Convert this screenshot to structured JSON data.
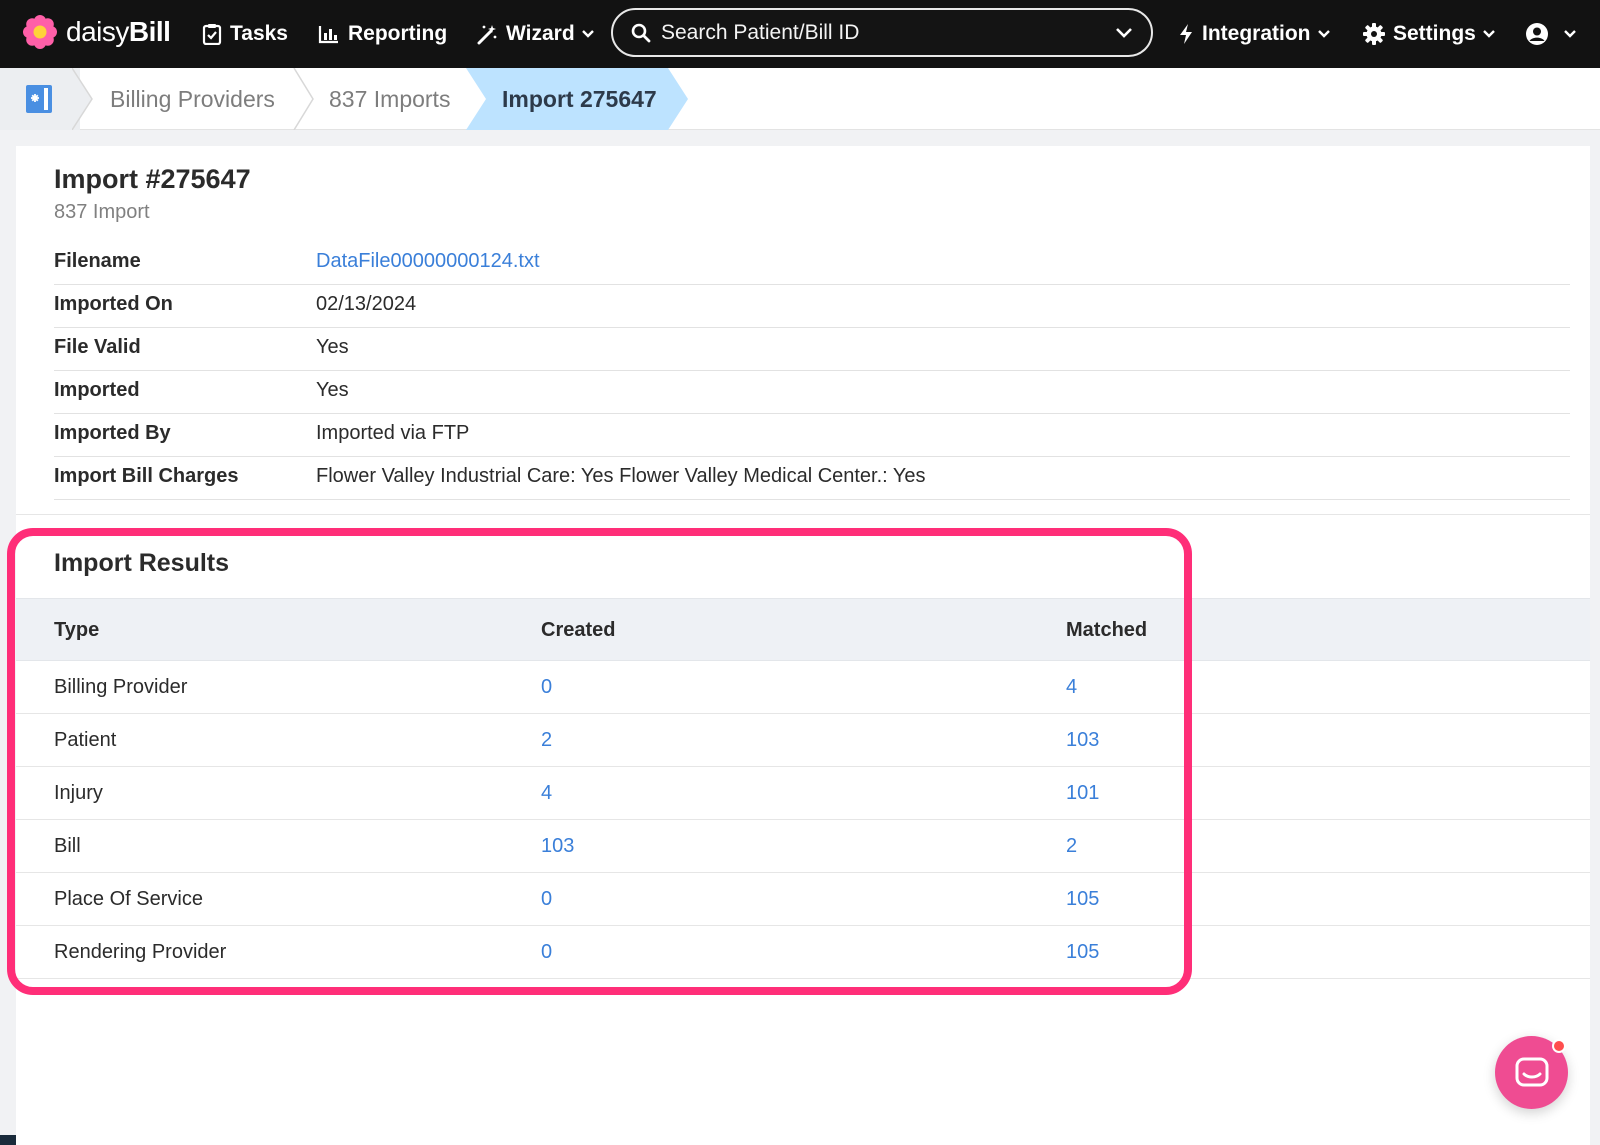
{
  "brand": {
    "name_light": "daisy",
    "name_bold": "Bill"
  },
  "nav": {
    "tasks": "Tasks",
    "reporting": "Reporting",
    "wizard": "Wizard",
    "search_placeholder": "Search Patient/Bill ID",
    "integration": "Integration",
    "settings": "Settings"
  },
  "breadcrumb": {
    "items": [
      "Billing Providers",
      "837 Imports",
      "Import 275647"
    ]
  },
  "import": {
    "title": "Import #275647",
    "subtitle": "837 Import",
    "details": [
      {
        "label": "Filename",
        "value": "DataFile00000000124.txt"
      },
      {
        "label": "Imported On",
        "value": "02/13/2024"
      },
      {
        "label": "File Valid",
        "value": "Yes"
      },
      {
        "label": "Imported",
        "value": "Yes"
      },
      {
        "label": "Imported By",
        "value": "Imported via FTP"
      },
      {
        "label": "Import Bill Charges",
        "value": "Flower Valley Industrial Care: Yes Flower Valley Medical Center.: Yes"
      }
    ]
  },
  "results": {
    "title": "Import Results",
    "columns": [
      "Type",
      "Created",
      "Matched"
    ],
    "rows": [
      {
        "type": "Billing Provider",
        "created": "0",
        "matched": "4"
      },
      {
        "type": "Patient",
        "created": "2",
        "matched": "103"
      },
      {
        "type": "Injury",
        "created": "4",
        "matched": "101"
      },
      {
        "type": "Bill",
        "created": "103",
        "matched": "2"
      },
      {
        "type": "Place Of Service",
        "created": "0",
        "matched": "105"
      },
      {
        "type": "Rendering Provider",
        "created": "0",
        "matched": "105"
      }
    ]
  },
  "colors": {
    "nav_bg": "#121212",
    "link": "#3a7fd9",
    "highlight": "#ff2e78",
    "breadcrumb_active": "#bde3ff",
    "chat": "#ef4c92"
  }
}
